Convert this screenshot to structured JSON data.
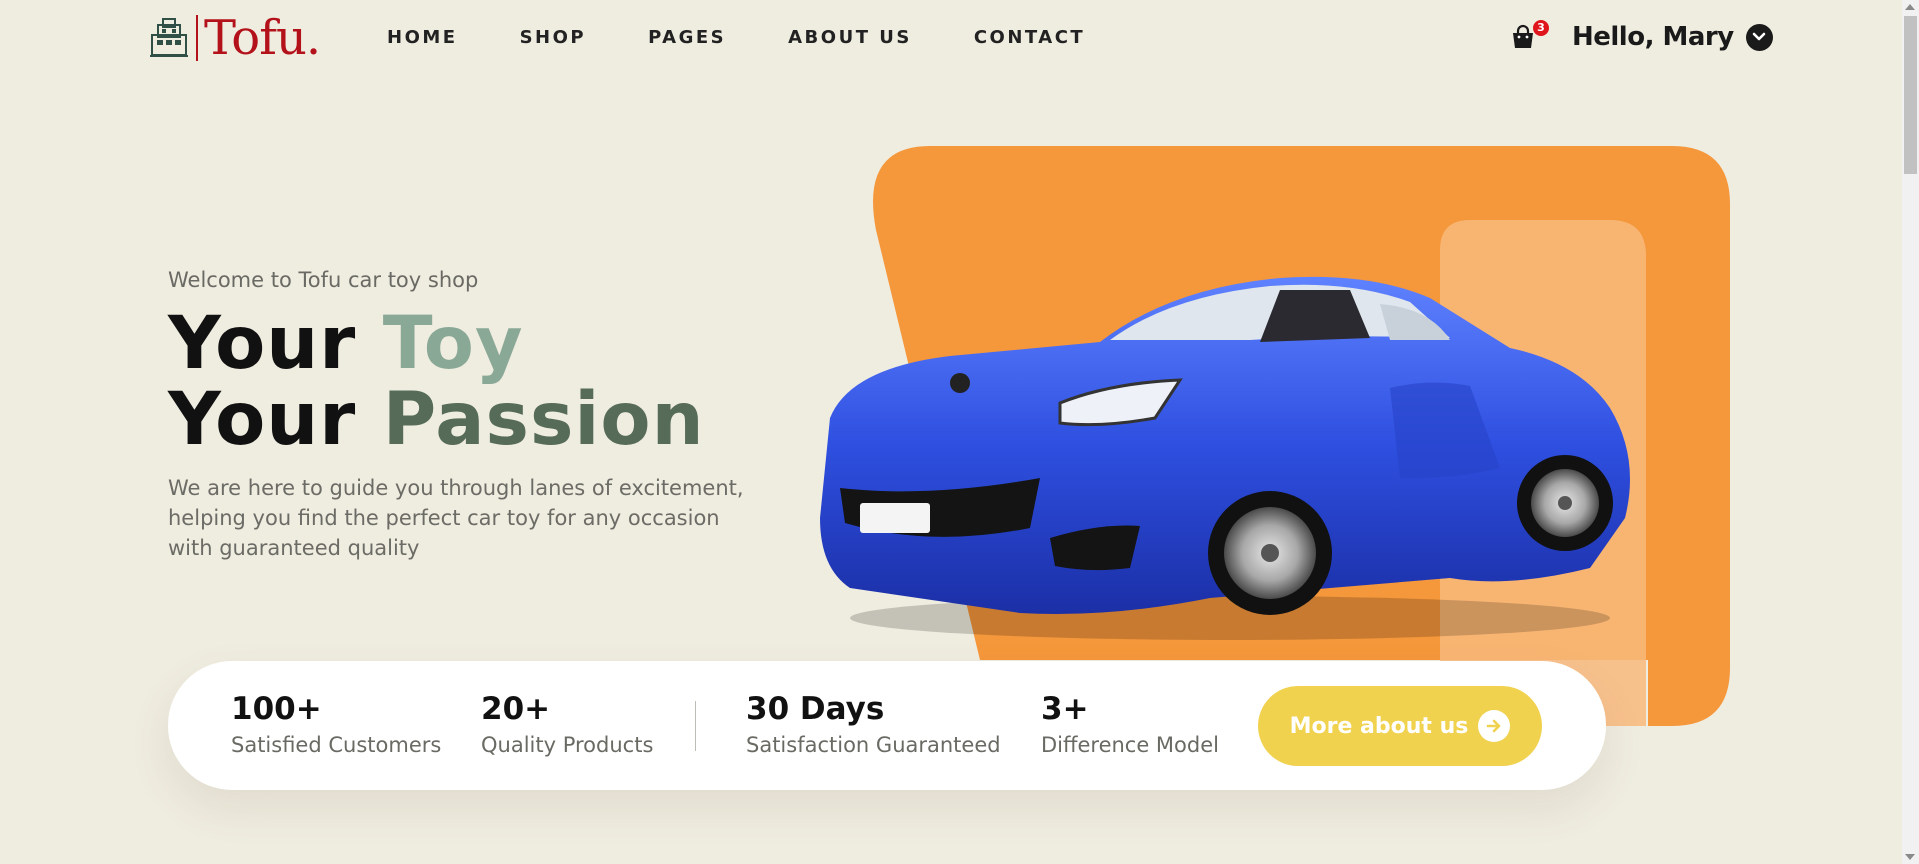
{
  "header": {
    "logo_text": "Tofu.",
    "nav": [
      {
        "label": "HOME"
      },
      {
        "label": "SHOP"
      },
      {
        "label": "PAGES"
      },
      {
        "label": "ABOUT US"
      },
      {
        "label": "CONTACT"
      }
    ],
    "cart_count": "3",
    "user_greeting": "Hello, Mary"
  },
  "hero": {
    "welcome": "Welcome to Tofu car toy shop",
    "line1_prefix": "Your ",
    "line1_accent": "Toy",
    "line2_prefix": "Your ",
    "line2_accent": "Passion",
    "description": "We are here to guide you through lanes of excitement, helping you find the perfect car toy for any occasion with guaranteed quality"
  },
  "stats": [
    {
      "value": "100+",
      "label": "Satisfied Customers"
    },
    {
      "value": "20+",
      "label": "Quality Products"
    },
    {
      "value": "30 Days",
      "label": "Satisfaction Guaranteed"
    },
    {
      "value": "3+",
      "label": "Difference Model"
    }
  ],
  "cta": {
    "label": "More about us"
  },
  "colors": {
    "background": "#efece0",
    "brand_red": "#b3121a",
    "hero_orange": "#f5973b",
    "accent_green": "#8aa896",
    "dark_green": "#566b58",
    "cta_yellow": "#f0d24f",
    "car_blue": "#2e4fe0"
  },
  "icons": {
    "cart": "shopping-bag-icon",
    "caret": "chevron-down-icon",
    "cta_arrow": "arrow-right-circle-icon",
    "logo": "castle-tofu-icon"
  }
}
